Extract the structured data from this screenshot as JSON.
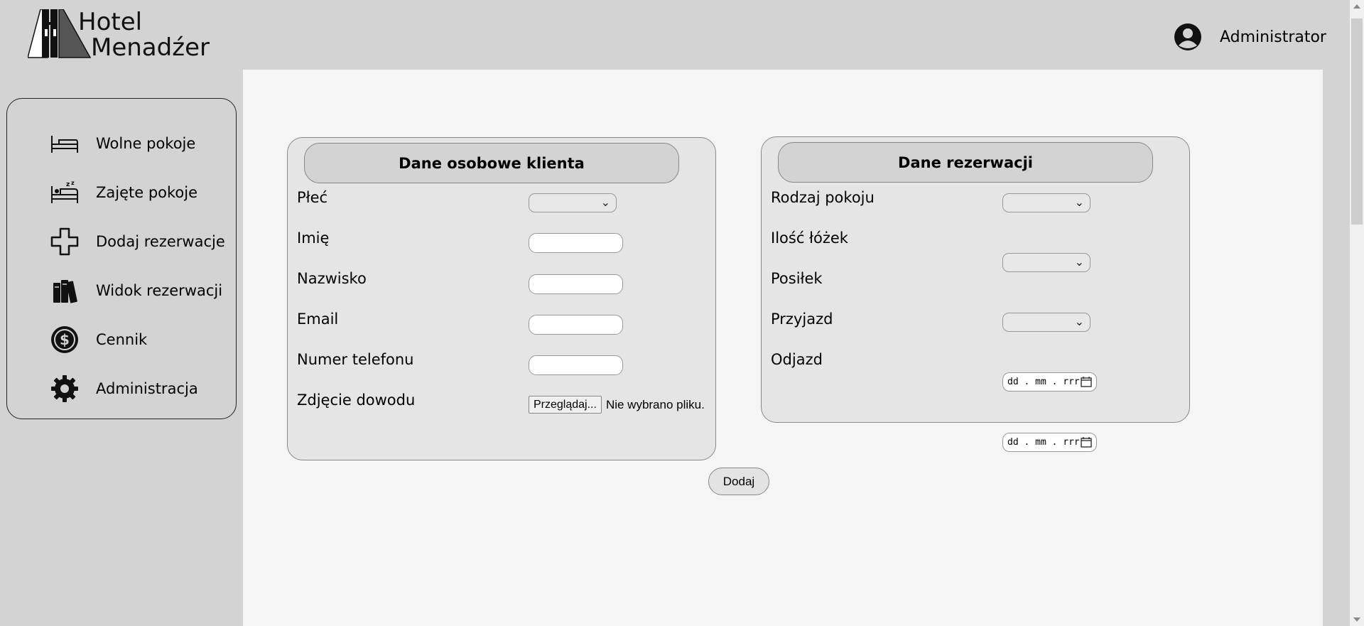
{
  "header": {
    "logo_line1": "Hotel",
    "logo_line2": "Menadźer",
    "user_name": "Administrator",
    "user_icon": "user-circle-icon"
  },
  "sidebar": {
    "items": [
      {
        "label": "Wolne pokoje",
        "icon": "bed-icon"
      },
      {
        "label": "Zajęte pokoje",
        "icon": "sleeping-bed-icon"
      },
      {
        "label": "Dodaj rezerwacje",
        "icon": "plus-outline-icon"
      },
      {
        "label": "Widok rezerwacji",
        "icon": "books-icon"
      },
      {
        "label": "Cennik",
        "icon": "dollar-coin-icon"
      },
      {
        "label": "Administracja",
        "icon": "gear-icon"
      }
    ]
  },
  "client_form": {
    "title": "Dane osobowe klienta",
    "fields": {
      "gender": {
        "label": "Płeć",
        "value": ""
      },
      "first_name": {
        "label": "Imię",
        "value": ""
      },
      "last_name": {
        "label": "Nazwisko",
        "value": ""
      },
      "email": {
        "label": "Email",
        "value": ""
      },
      "phone": {
        "label": "Numer telefonu",
        "value": ""
      },
      "id_photo": {
        "label": "Zdjęcie dowodu",
        "button": "Przeglądaj...",
        "status": "Nie wybrano pliku."
      }
    }
  },
  "reservation_form": {
    "title": "Dane rezerwacji",
    "fields": {
      "room_type": {
        "label": "Rodzaj pokoju",
        "value": ""
      },
      "beds": {
        "label": "Ilość łóżek",
        "value": ""
      },
      "meal": {
        "label": "Posiłek",
        "value": ""
      },
      "arrival": {
        "label": "Przyjazd",
        "placeholder": "dd . mm . rrr"
      },
      "departure": {
        "label": "Odjazd",
        "placeholder": "dd . mm . rrr"
      }
    }
  },
  "submit_label": "Dodaj"
}
